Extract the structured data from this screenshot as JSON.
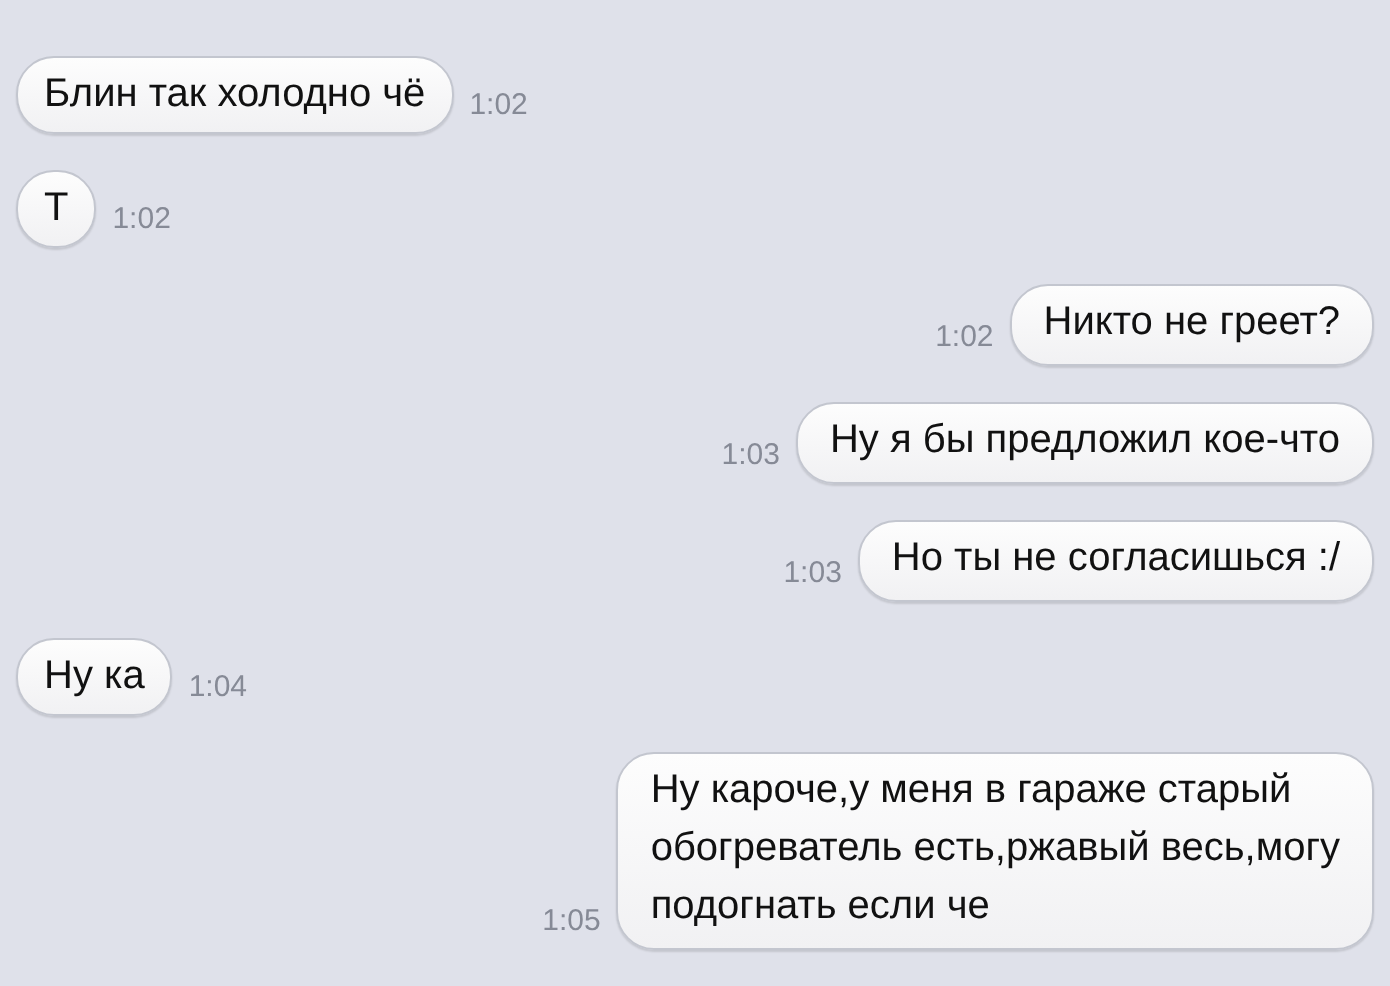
{
  "messages": [
    {
      "kind": "incoming",
      "text": "Блин так холодно чё",
      "time": "1:02"
    },
    {
      "kind": "incoming",
      "text": "Т",
      "time": "1:02"
    },
    {
      "kind": "outgoing",
      "text": "Никто не греет?",
      "time": "1:02"
    },
    {
      "kind": "outgoing",
      "text": "Ну я бы предложил кое-что",
      "time": "1:03"
    },
    {
      "kind": "outgoing",
      "text": "Но ты не согласишься :/",
      "time": "1:03"
    },
    {
      "kind": "incoming",
      "text": "Ну ка",
      "time": "1:04"
    },
    {
      "kind": "outgoing",
      "text": "Ну кароче,у меня в гараже старый\nобогреватель есть,ржавый весь,могу\nподогнать если че",
      "time": "1:05"
    }
  ]
}
